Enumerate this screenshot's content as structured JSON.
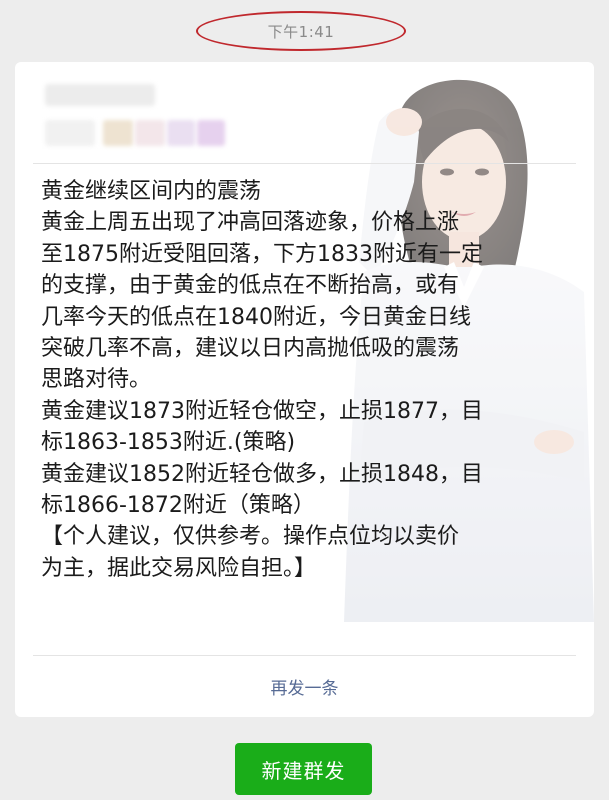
{
  "timestamp": "下午1:41",
  "message": {
    "lines": [
      "黄金继续区间内的震荡",
      "黄金上周五出现了冲高回落迹象，价格上涨",
      "至1875附近受阻回落，下方1833附近有一定",
      "的支撑，由于黄金的低点在不断抬高，或有",
      "几率今天的低点在1840附近，今日黄金日线",
      "突破几率不高，建议以日内高抛低吸的震荡",
      "思路对待。",
      "黄金建议1873附近轻仓做空，止损1877，目",
      "标1863-1853附近.(策略)",
      "黄金建议1852附近轻仓做多，止损1848，目",
      "标1866-1872附近（策略）",
      "【个人建议，仅供参考。操作点位均以卖价",
      "为主，据此交易风险自担。】"
    ]
  },
  "actions": {
    "resend_label": "再发一条",
    "new_broadcast_label": "新建群发"
  },
  "colors": {
    "background": "#ededed",
    "card": "#ffffff",
    "link": "#576b95",
    "primary_button": "#1aad19",
    "highlight_circle": "#c0282d"
  }
}
